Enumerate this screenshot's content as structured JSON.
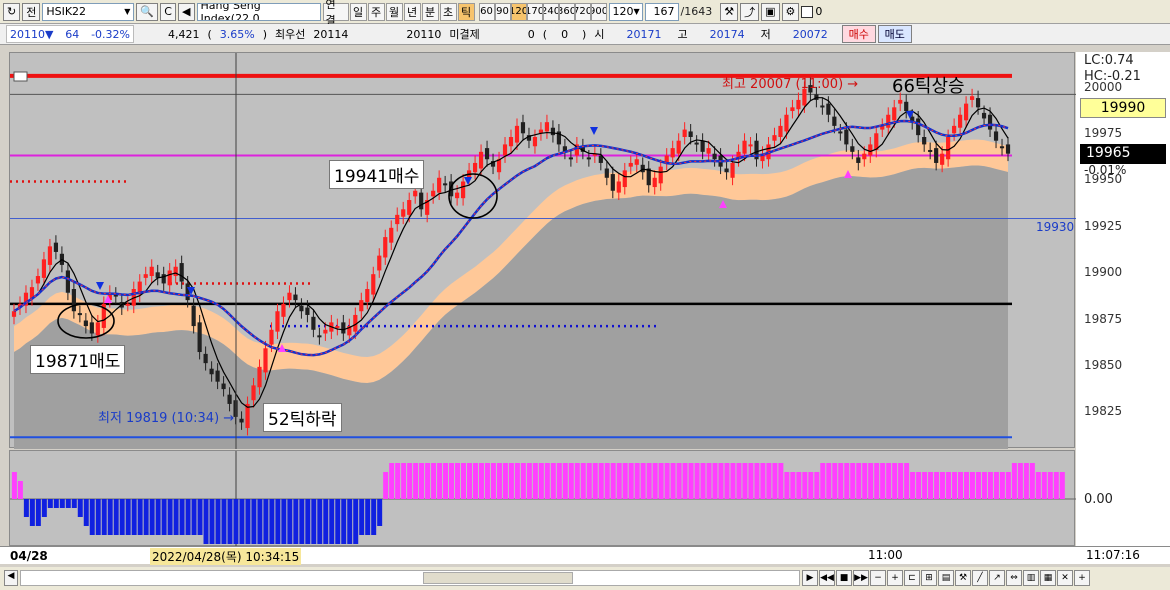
{
  "toolbar": {
    "mode_label": "전",
    "symbol": "HSIK22",
    "instrument_name": "Hang Seng Index(22.0",
    "type_buttons": [
      "연결",
      "일",
      "주",
      "월",
      "년",
      "분",
      "초",
      "틱"
    ],
    "active_type": "틱",
    "tick_intervals": [
      "60",
      "90",
      "120",
      "170",
      "240",
      "360",
      "720",
      "900"
    ],
    "active_interval": "120",
    "interval_value": "120",
    "bar_count": "167",
    "bar_total": "/1643",
    "checkbox_label": "0"
  },
  "quote": {
    "price": "20110",
    "direction": "▼",
    "change": "64",
    "change_pct": "-0.32%",
    "volume": "4,421",
    "volume_pct_open": "(",
    "volume_pct": "3.65%",
    "volume_pct_close": ")",
    "best_ask_label": "최우선",
    "best_ask": "20114",
    "best_bid": "20110",
    "unfilled_label": "미결제",
    "unfilled_value": "0",
    "unfilled_paren": "(    0    )",
    "open_label": "시",
    "open": "20171",
    "high_label": "고",
    "high": "20174",
    "low_label": "저",
    "low": "20072",
    "buy_label": "매수",
    "sell_label": "매도"
  },
  "annotations": {
    "sell_label": "19871매도",
    "buy_label": "19941매수",
    "drop_label": "52틱하락",
    "rise_label": "66틱상승",
    "high_marker": "최고 20007 (11:00) →",
    "low_marker": "최저 19819 (10:34) →",
    "level_1930": "19930"
  },
  "price_axis": {
    "lc": "LC:0.74",
    "hc": "HC:-0.21",
    "current_box": "19990",
    "close_box": "19965",
    "change_pct": "-0.01%",
    "ticks": [
      "20000",
      "19975",
      "19950",
      "19925",
      "19900",
      "19875",
      "19850",
      "19825"
    ]
  },
  "oscillator_axis": {
    "zero": "0.00"
  },
  "time_axis": {
    "start_date": "04/28",
    "cursor_time": "2022/04/28(목) 10:34:15",
    "mid_time": "11:00",
    "end_time": "11:07:16"
  },
  "colors": {
    "up_candle": "#ff2020",
    "down_candle": "#202020",
    "ma_blue": "#1030d0",
    "ma_magenta": "#e020e0",
    "band_orange": "#ffc898",
    "band_gray": "#a0a0a0",
    "osc_pos": "#ff40ff",
    "osc_neg": "#1020e0",
    "accent_orange": "#f7c46c"
  },
  "chart_data": {
    "type": "candlestick",
    "y_range": [
      19810,
      20015
    ],
    "reference_lines": [
      {
        "value": 20007,
        "color": "#ee1111"
      },
      {
        "value": 19964,
        "color": "#dd22dd"
      },
      {
        "value": 19884,
        "color": "#000000"
      },
      {
        "value": 19812,
        "color": "#2050e0"
      }
    ],
    "closes": [
      19880,
      19884,
      19890,
      19893,
      19899,
      19908,
      19915,
      19912,
      19905,
      19890,
      19880,
      19878,
      19872,
      19868,
      19874,
      19884,
      19890,
      19888,
      19882,
      19884,
      19892,
      19896,
      19900,
      19904,
      19898,
      19895,
      19902,
      19904,
      19896,
      19886,
      19872,
      19858,
      19852,
      19846,
      19842,
      19838,
      19830,
      19823,
      19820,
      19830,
      19840,
      19850,
      19860,
      19870,
      19880,
      19884,
      19890,
      19886,
      19880,
      19878,
      19870,
      19866,
      19870,
      19874,
      19872,
      19868,
      19872,
      19878,
      19886,
      19892,
      19900,
      19910,
      19920,
      19925,
      19932,
      19935,
      19940,
      19945,
      19935,
      19940,
      19945,
      19952,
      19948,
      19942,
      19944,
      19950,
      19956,
      19960,
      19966,
      19962,
      19958,
      19962,
      19970,
      19974,
      19980,
      19976,
      19972,
      19974,
      19978,
      19982,
      19975,
      19970,
      19966,
      19962,
      19970,
      19966,
      19962,
      19965,
      19960,
      19952,
      19945,
      19950,
      19956,
      19960,
      19962,
      19955,
      19948,
      19952,
      19958,
      19964,
      19968,
      19972,
      19978,
      19974,
      19970,
      19966,
      19968,
      19962,
      19958,
      19955,
      19960,
      19966,
      19972,
      19970,
      19962,
      19965,
      19970,
      19975,
      19980,
      19986,
      19990,
      19994,
      20000,
      19998,
      19994,
      19990,
      19986,
      19980,
      19976,
      19970,
      19966,
      19960,
      19965,
      19970,
      19976,
      19980,
      19986,
      19990,
      19994,
      19988,
      19982,
      19975,
      19970,
      19966,
      19960,
      19965,
      19974,
      19980,
      19986,
      19992,
      19996,
      19990,
      19984,
      19978,
      19972,
      19968,
      19965
    ],
    "oscillator": [
      3,
      2,
      -2,
      -3,
      -3,
      -2,
      -1,
      -1,
      -1,
      -1,
      -1,
      -2,
      -3,
      -4,
      -4,
      -4,
      -4,
      -4,
      -4,
      -4,
      -4,
      -4,
      -4,
      -4,
      -4,
      -4,
      -4,
      -4,
      -4,
      -4,
      -4,
      -4,
      -5,
      -5,
      -5,
      -5,
      -5,
      -5,
      -5,
      -5,
      -5,
      -5,
      -5,
      -5,
      -5,
      -5,
      -5,
      -5,
      -5,
      -5,
      -5,
      -5,
      -5,
      -5,
      -5,
      -5,
      -5,
      -5,
      -4,
      -4,
      -4,
      -3,
      3,
      4,
      4,
      4,
      4,
      4,
      4,
      4,
      4,
      4,
      4,
      4,
      4,
      4,
      4,
      4,
      4,
      4,
      4,
      4,
      4,
      4,
      4,
      4,
      4,
      4,
      4,
      4,
      4,
      4,
      4,
      4,
      4,
      4,
      4,
      4,
      4,
      4,
      4,
      4,
      4,
      4,
      4,
      4,
      4,
      4,
      4,
      4,
      4,
      4,
      4,
      4,
      4,
      4,
      4,
      4,
      4,
      4,
      4,
      4,
      4,
      4,
      4,
      4,
      4,
      4,
      4,
      3,
      3,
      3,
      3,
      3,
      3,
      4,
      4,
      4,
      4,
      4,
      4,
      4,
      4,
      4,
      4,
      4,
      4,
      4,
      4,
      4,
      3,
      3,
      3,
      3,
      3,
      3,
      3,
      3,
      3,
      3,
      3,
      3,
      3,
      3,
      3,
      3,
      3,
      4,
      4,
      4,
      4,
      3,
      3,
      3,
      3,
      3
    ],
    "ylim": [
      19810,
      20015
    ]
  }
}
